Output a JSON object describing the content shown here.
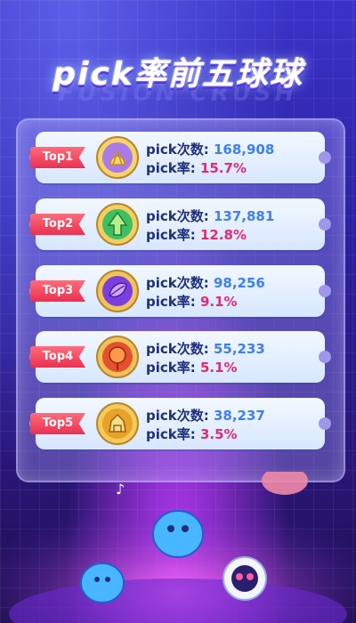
{
  "header": {
    "title": "pick率前五球球",
    "watermark": "FUSION CRUSH"
  },
  "rankings": [
    {
      "rank_label": "Top1",
      "count_label": "pick次数:",
      "count_value": "168,908",
      "rate_label": "pick率:",
      "rate_value": "15.7%",
      "icon": "golden-fan-orb-icon",
      "color": "#f2c24c"
    },
    {
      "rank_label": "Top2",
      "count_label": "pick次数:",
      "count_value": "137,881",
      "rate_label": "pick率:",
      "rate_value": "12.8%",
      "icon": "green-arrow-orb-icon",
      "color": "#39c56c"
    },
    {
      "rank_label": "Top3",
      "count_label": "pick次数:",
      "count_value": "98,256",
      "rate_label": "pick率:",
      "rate_value": "9.1%",
      "icon": "purple-leaf-orb-icon",
      "color": "#8a47e6"
    },
    {
      "rank_label": "Top4",
      "count_label": "pick次数:",
      "count_value": "55,233",
      "rate_label": "pick率:",
      "rate_value": "5.1%",
      "icon": "red-flame-orb-icon",
      "color": "#e24b28"
    },
    {
      "rank_label": "Top5",
      "count_label": "pick次数:",
      "count_value": "38,237",
      "rate_label": "pick率:",
      "rate_value": "3.5%",
      "icon": "golden-tower-orb-icon",
      "color": "#efb22a"
    }
  ]
}
